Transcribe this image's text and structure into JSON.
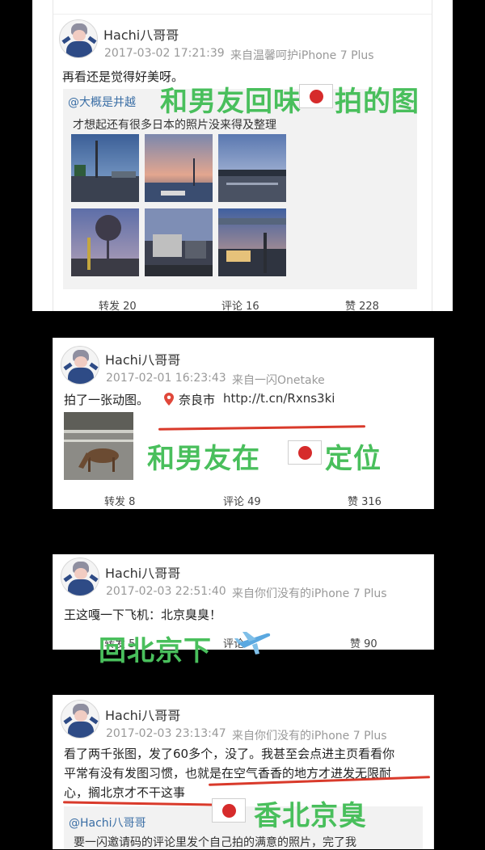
{
  "posts": [
    {
      "username": "Hachi八哥哥",
      "time": "2017-03-02 17:21:39",
      "source": "来自温馨呵护iPhone 7 Plus",
      "text": "再看还是觉得好美呀。",
      "quote_user": "@大概是井越",
      "quote_text": "才想起还有很多日本的照片没来得及整理",
      "stats": {
        "repost": "转发 20",
        "comment": "评论 16",
        "like": "赞 228"
      }
    },
    {
      "username": "Hachi八哥哥",
      "time": "2017-02-01 16:23:43",
      "source": "来自一闪Onetake",
      "text": "拍了一张动图。",
      "location": "奈良市",
      "link": "http://t.cn/Rxns3ki",
      "stats": {
        "repost": "转发 8",
        "comment": "评论 49",
        "like": "赞 316"
      }
    },
    {
      "username": "Hachi八哥哥",
      "time": "2017-02-03 22:51:40",
      "source": "来自你们没有的iPhone 7 Plus",
      "text": "王这嘎一下飞机：北京臭臭！",
      "stats": {
        "repost": "转发 5",
        "comment": "评论",
        "like": "赞 90"
      }
    },
    {
      "username": "Hachi八哥哥",
      "time": "2017-02-03 23:13:47",
      "source": "来自你们没有的iPhone 7 Plus",
      "text_line1": "看了两千张图，发了60多个，没了。我甚至会点进主页看看你",
      "text_line2": "平常有没有发图习惯，也就是在空气香香的地方才进发无限耐",
      "text_line3": "心，搁北京才不干这事",
      "quote_user": "@Hachi八哥哥",
      "quote_text": "要一闪邀请码的评论里发个自己拍的满意的照片，完了我"
    }
  ],
  "annotations": {
    "a1": "和男友回味",
    "a1_tail": "拍的图",
    "a2": "和男友在",
    "a2_tail": "定位",
    "a3": "回北京下",
    "a4": "香北京臭"
  },
  "colors": {
    "annotation_green": "#49bf5c",
    "underline_red": "#d93a2b",
    "link_blue": "#3a6ea5"
  }
}
